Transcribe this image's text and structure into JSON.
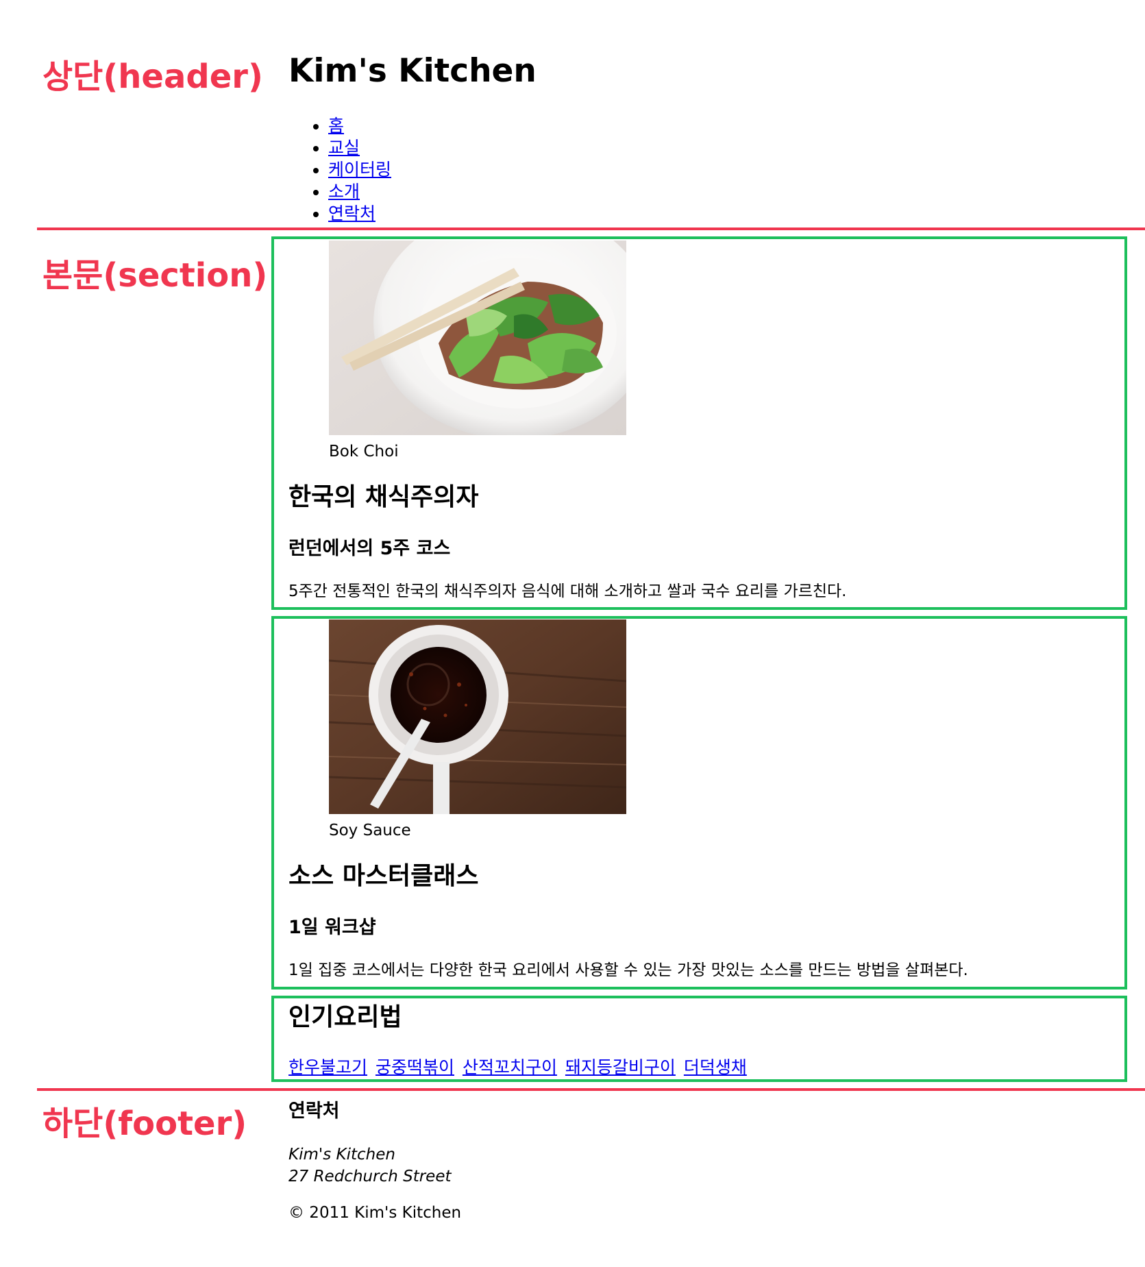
{
  "annotations": {
    "header": "상단(header)",
    "section": "본문(section)",
    "footer": "하단(footer)"
  },
  "colors": {
    "annotation_red": "#f0364f",
    "section_green": "#1dbf5c",
    "link_blue": "#0000ee"
  },
  "header": {
    "site_title": "Kim's Kitchen",
    "nav": [
      {
        "label": "홈"
      },
      {
        "label": "교실"
      },
      {
        "label": "케이터링"
      },
      {
        "label": "소개"
      },
      {
        "label": "연락처"
      }
    ]
  },
  "articles": [
    {
      "image_caption": "Bok Choi",
      "title": "한국의 채식주의자",
      "subtitle": "런던에서의 5주 코스",
      "description": "5주간 전통적인 한국의 채식주의자 음식에 대해 소개하고 쌀과 국수 요리를 가르친다."
    },
    {
      "image_caption": "Soy Sauce",
      "title": "소스 마스터클래스",
      "subtitle": "1일 워크샵",
      "description": "1일 집중 코스에서는 다양한 한국 요리에서 사용할 수 있는 가장 맛있는 소스를 만드는 방법을 살펴본다."
    }
  ],
  "popular": {
    "title": "인기요리법",
    "links": [
      {
        "label": "한우불고기"
      },
      {
        "label": "궁중떡볶이"
      },
      {
        "label": "산적꼬치구이"
      },
      {
        "label": "돼지등갈비구이"
      },
      {
        "label": "더덕생채"
      }
    ]
  },
  "footer": {
    "heading": "연락처",
    "address_line1": "Kim's Kitchen",
    "address_line2": "27 Redchurch Street",
    "copyright": "© 2011 Kim's Kitchen"
  }
}
